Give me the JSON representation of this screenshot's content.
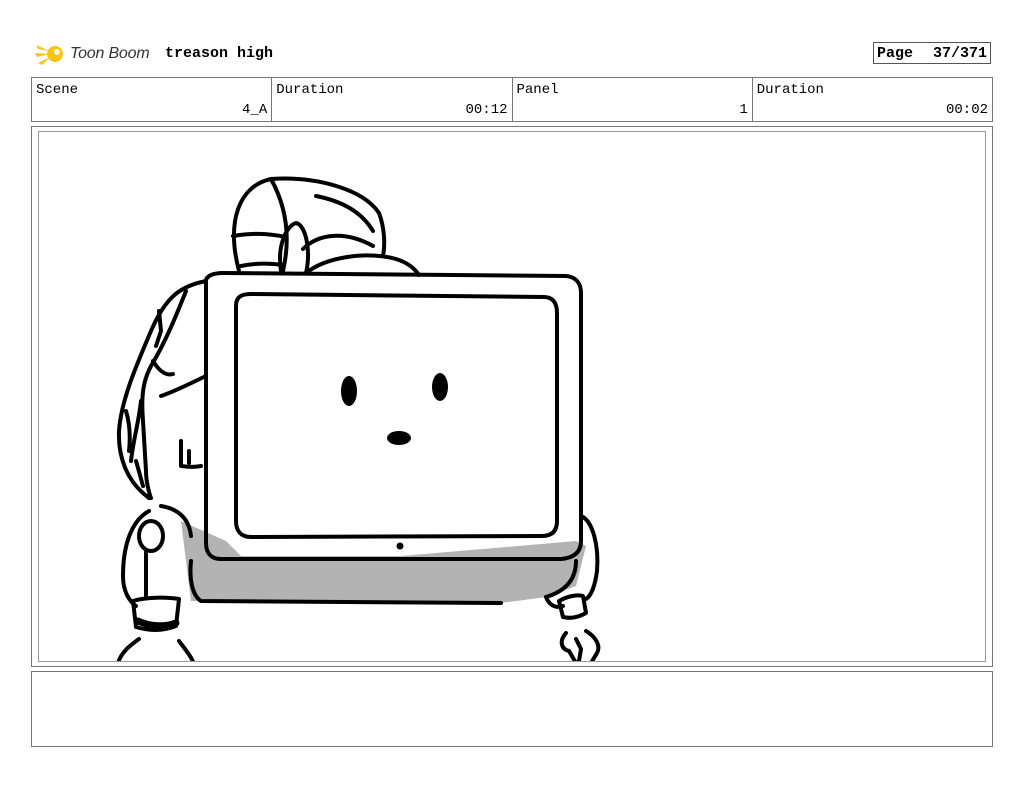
{
  "header": {
    "logo_text": "Toon Boom",
    "project_title": "treason high",
    "page_label": "Page",
    "page_number": "37/371"
  },
  "info": {
    "scene_label": "Scene",
    "scene_value": "4_A",
    "scene_duration_label": "Duration",
    "scene_duration_value": "00:12",
    "panel_label": "Panel",
    "panel_value": "1",
    "panel_duration_label": "Duration",
    "panel_duration_value": "00:02"
  },
  "notes": {
    "text": ""
  },
  "colors": {
    "logo_accent": "#f5c518",
    "shadow_fill": "#b3b3b3",
    "border": "#777777"
  }
}
